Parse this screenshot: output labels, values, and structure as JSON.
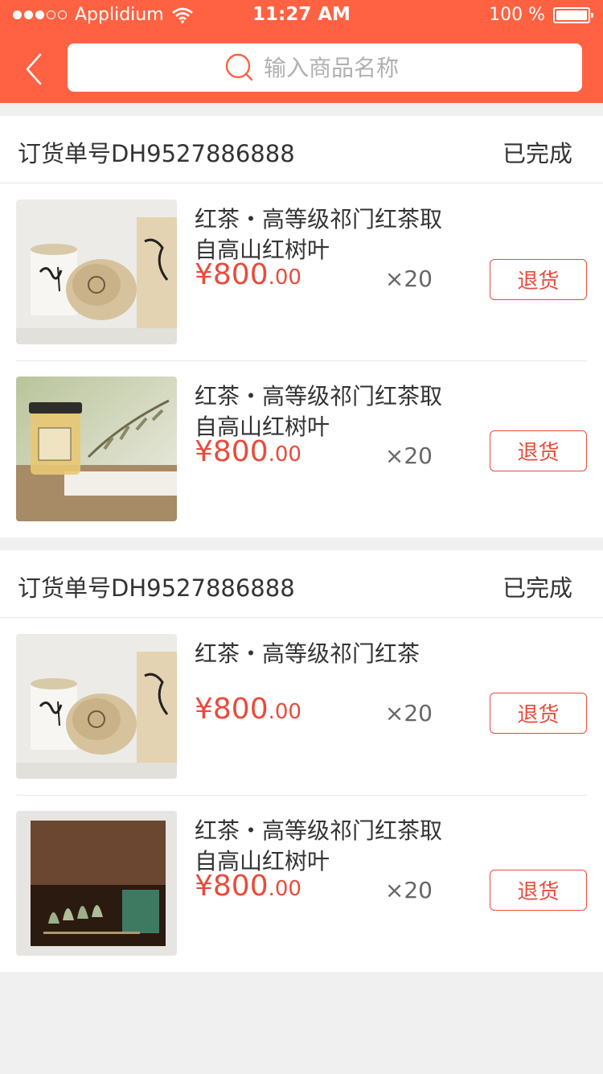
{
  "status_bar": {
    "carrier": "Applidium",
    "time": "11:27 AM",
    "battery": "100 %"
  },
  "search": {
    "placeholder": "输入商品名称"
  },
  "orders": [
    {
      "order_no": "订货单号DH9527886888",
      "status": "已完成",
      "items": [
        {
          "name": "红茶・高等级祁门红茶取自高山红树叶",
          "price_int": "¥800",
          "price_dec": ".00",
          "qty": "×20",
          "action": "退货",
          "image": "tea-canister-package"
        },
        {
          "name": "红茶・高等级祁门红茶取自高山红树叶",
          "price_int": "¥800",
          "price_dec": ".00",
          "qty": "×20",
          "action": "退货",
          "image": "honey-jar-package"
        }
      ]
    },
    {
      "order_no": "订货单号DH9527886888",
      "status": "已完成",
      "items": [
        {
          "name": "红茶・高等级祁门红茶",
          "price_int": "¥800",
          "price_dec": ".00",
          "qty": "×20",
          "action": "退货",
          "image": "tea-canister-package"
        },
        {
          "name": "红茶・高等级祁门红茶取自高山红树叶",
          "price_int": "¥800",
          "price_dec": ".00",
          "qty": "×20",
          "action": "退货",
          "image": "wooden-tea-box"
        }
      ]
    }
  ],
  "colors": {
    "accent": "#fe6242",
    "price": "#e94b3c"
  }
}
